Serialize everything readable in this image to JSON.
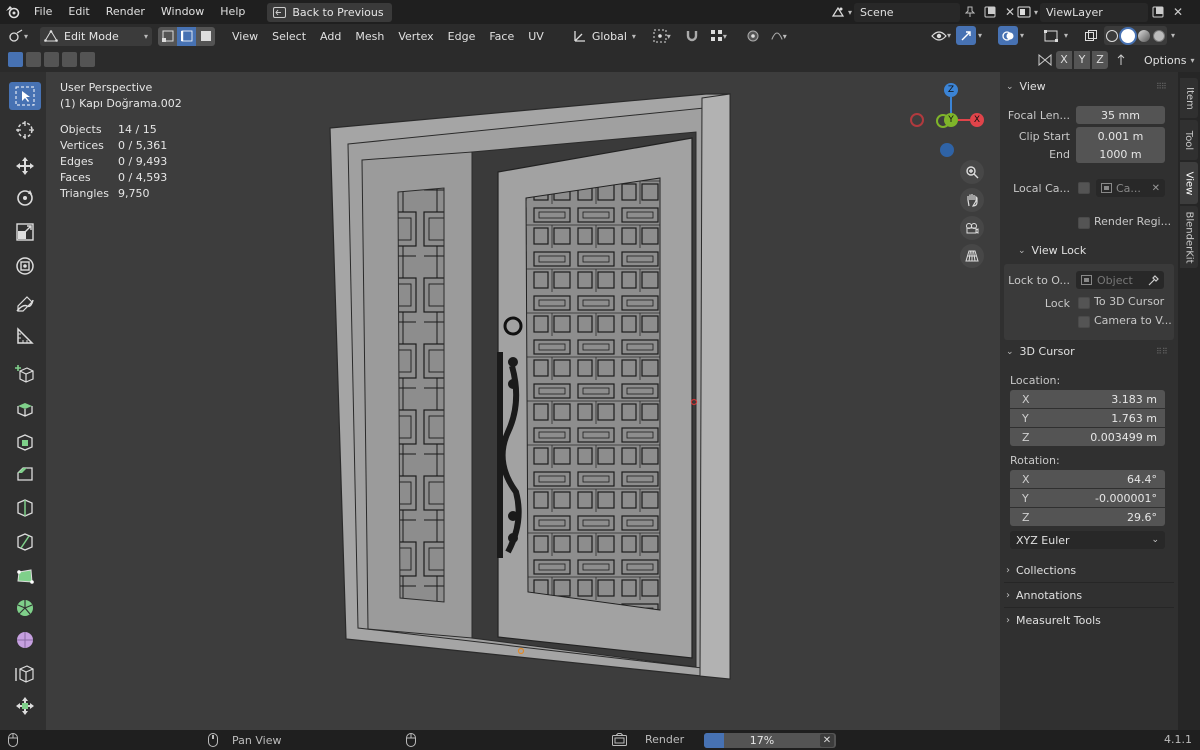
{
  "menubar": {
    "items": [
      "File",
      "Edit",
      "Render",
      "Window",
      "Help"
    ],
    "back_button": "Back to Previous",
    "scene": "Scene",
    "view_layer": "ViewLayer"
  },
  "header": {
    "mode": "Edit Mode",
    "menus": [
      "View",
      "Select",
      "Add",
      "Mesh",
      "Vertex",
      "Edge",
      "Face",
      "UV"
    ],
    "orientation": "Global",
    "axes": [
      "X",
      "Y",
      "Z"
    ],
    "options": "Options"
  },
  "viewport": {
    "perspective": "User Perspective",
    "object_name": "(1) Kapı Doğrama.002",
    "stats": [
      {
        "label": "Objects",
        "value": "14 / 15"
      },
      {
        "label": "Vertices",
        "value": "0 / 5,361"
      },
      {
        "label": "Edges",
        "value": "0 / 9,493"
      },
      {
        "label": "Faces",
        "value": "0 / 4,593"
      },
      {
        "label": "Triangles",
        "value": "9,750"
      }
    ],
    "gizmo": {
      "x": "X",
      "y": "Y",
      "z": "Z"
    }
  },
  "sidebar": {
    "tabs": [
      "Item",
      "Tool",
      "View",
      "BlenderKit"
    ],
    "view_panel": {
      "title": "View",
      "focal_length_label": "Focal Len...",
      "focal_length": "35 mm",
      "clip_start_label": "Clip Start",
      "clip_start": "0.001 m",
      "end_label": "End",
      "end": "1000 m",
      "local_camera_label": "Local Ca...",
      "local_camera_value": "Ca...",
      "render_region": "Render Regi...",
      "view_lock_title": "View Lock",
      "lock_to_object_label": "Lock to O...",
      "lock_to_object_placeholder": "Object",
      "lock_label": "Lock",
      "to_3d_cursor": "To 3D Cursor",
      "camera_to_view": "Camera to V..."
    },
    "cursor_panel": {
      "title": "3D Cursor",
      "location_label": "Location:",
      "location": [
        {
          "axis": "X",
          "value": "3.183 m"
        },
        {
          "axis": "Y",
          "value": "1.763 m"
        },
        {
          "axis": "Z",
          "value": "0.003499 m"
        }
      ],
      "rotation_label": "Rotation:",
      "rotation": [
        {
          "axis": "X",
          "value": "64.4°"
        },
        {
          "axis": "Y",
          "value": "-0.000001°"
        },
        {
          "axis": "Z",
          "value": "29.6°"
        }
      ],
      "rotation_mode": "XYZ Euler"
    },
    "collapsed_panels": [
      "Collections",
      "Annotations",
      "MeasureIt Tools"
    ]
  },
  "statusbar": {
    "pan_view": "Pan View",
    "render": "Render",
    "progress_text": "17%",
    "progress_fraction": 0.17,
    "version": "4.1.1"
  },
  "colors": {
    "accent": "#4772b3",
    "axis_x": "#e0444a",
    "axis_y": "#7fb52a",
    "axis_z": "#3b84d6"
  }
}
